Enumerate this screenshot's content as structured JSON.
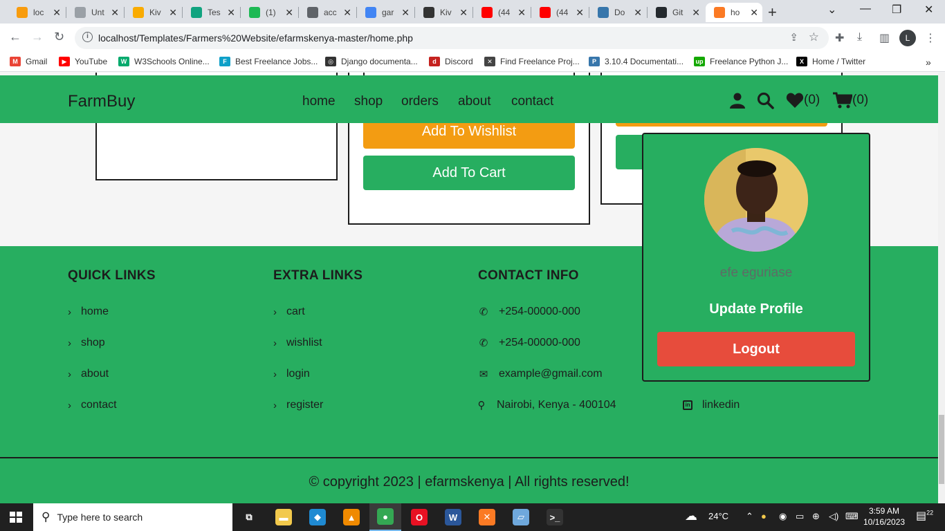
{
  "browser": {
    "tabs": [
      {
        "title": "loc",
        "icon": "phpmyadmin-icon",
        "color": "#f89c0e"
      },
      {
        "title": "Unt",
        "icon": "colab-icon",
        "color": "#9aa0a6"
      },
      {
        "title": "Kiv",
        "icon": "colab-icon",
        "color": "#f9ab00"
      },
      {
        "title": "Tes",
        "icon": "openai-icon",
        "color": "#10a37f"
      },
      {
        "title": "(1)",
        "icon": "notification-icon",
        "color": "#1db954"
      },
      {
        "title": "acc",
        "icon": "globe-icon",
        "color": "#5f6368"
      },
      {
        "title": "gar",
        "icon": "google-icon",
        "color": "#4285f4"
      },
      {
        "title": "Kiv",
        "icon": "site-icon",
        "color": "#333333"
      },
      {
        "title": "(44",
        "icon": "youtube-icon",
        "color": "#ff0000"
      },
      {
        "title": "(44",
        "icon": "youtube-icon",
        "color": "#ff0000"
      },
      {
        "title": "Do",
        "icon": "python-doc-icon",
        "color": "#3776ab"
      },
      {
        "title": "Git",
        "icon": "github-icon",
        "color": "#24292e"
      },
      {
        "title": "ho",
        "icon": "xampp-icon",
        "color": "#fb7a24"
      }
    ],
    "close_glyph": "✕",
    "new_tab": "+",
    "url": "localhost/Templates/Farmers%20Website/efarmskenya-master/home.php",
    "profile_initial": "L",
    "bookmarks": [
      {
        "label": "Gmail",
        "icon": "gmail-icon",
        "color": "#ea4335",
        "glyph": "M"
      },
      {
        "label": "YouTube",
        "icon": "youtube-icon",
        "color": "#ff0000",
        "glyph": "▶"
      },
      {
        "label": "W3Schools Online...",
        "icon": "w3schools-icon",
        "color": "#04aa6d",
        "glyph": "W"
      },
      {
        "label": "Best Freelance Jobs...",
        "icon": "freelance-icon",
        "color": "#0fa0c8",
        "glyph": "F"
      },
      {
        "label": "Django documenta...",
        "icon": "django-icon",
        "color": "#333333",
        "glyph": "◎"
      },
      {
        "label": "Discord",
        "icon": "discord-icon",
        "color": "#c5221f",
        "glyph": "d"
      },
      {
        "label": "Find Freelance Proj...",
        "icon": "tools-icon",
        "color": "#444444",
        "glyph": "✕"
      },
      {
        "label": "3.10.4 Documentati...",
        "icon": "python-icon",
        "color": "#3776ab",
        "glyph": "P"
      },
      {
        "label": "Freelance Python J...",
        "icon": "upwork-icon",
        "color": "#14a800",
        "glyph": "up"
      },
      {
        "label": "Home / Twitter",
        "icon": "x-twitter-icon",
        "color": "#000000",
        "glyph": "X"
      }
    ]
  },
  "site": {
    "logo": "FarmBuy",
    "nav": [
      "home",
      "shop",
      "orders",
      "about",
      "contact"
    ],
    "wishlist_count": "(0)",
    "cart_count": "(0)",
    "cards": {
      "add_to_cart": "Add To Cart",
      "add_to_wishlist": "Add To Wishlist"
    },
    "profile": {
      "name": "efe eguriase",
      "update": "Update Profile",
      "logout": "Logout"
    },
    "footer": {
      "quick_links_title": "QUICK LINKS",
      "quick_links": [
        "home",
        "shop",
        "about",
        "contact"
      ],
      "extra_links_title": "EXTRA LINKS",
      "extra_links": [
        "cart",
        "wishlist",
        "login",
        "register"
      ],
      "contact_title": "CONTACT INFO",
      "contact": [
        {
          "text": "+254-00000-000",
          "icon": "phone-icon"
        },
        {
          "text": "+254-00000-000",
          "icon": "phone-icon"
        },
        {
          "text": "example@gmail.com",
          "icon": "envelope-icon"
        },
        {
          "text": "Nairobi, Kenya - 400104",
          "icon": "map-pin-icon"
        }
      ],
      "social_visible": {
        "text": "linkedin",
        "icon": "linkedin-icon"
      },
      "copyright": "© copyright 2023 | efarmskenya | All rights reserved!"
    }
  },
  "taskbar": {
    "search_placeholder": "Type here to search",
    "weather": "24°C",
    "time": "3:59 AM",
    "date": "10/16/2023",
    "notifications": "22",
    "apps": [
      {
        "name": "task-view-icon",
        "color": "#202020",
        "glyph": "⧉"
      },
      {
        "name": "file-explorer-icon",
        "color": "#f2c94c",
        "glyph": "▬"
      },
      {
        "name": "vscode-icon",
        "color": "#1f8ad2",
        "glyph": "◆"
      },
      {
        "name": "vlc-icon",
        "color": "#f08a00",
        "glyph": "▲"
      },
      {
        "name": "chrome-icon",
        "color": "#34a853",
        "glyph": "●"
      },
      {
        "name": "opera-icon",
        "color": "#e81123",
        "glyph": "O"
      },
      {
        "name": "word-icon",
        "color": "#2b579a",
        "glyph": "W"
      },
      {
        "name": "xampp-icon",
        "color": "#fb7a24",
        "glyph": "✕"
      },
      {
        "name": "notepad-icon",
        "color": "#6fa8dc",
        "glyph": "▱"
      },
      {
        "name": "terminal-icon",
        "color": "#333333",
        "glyph": ">_"
      }
    ]
  }
}
